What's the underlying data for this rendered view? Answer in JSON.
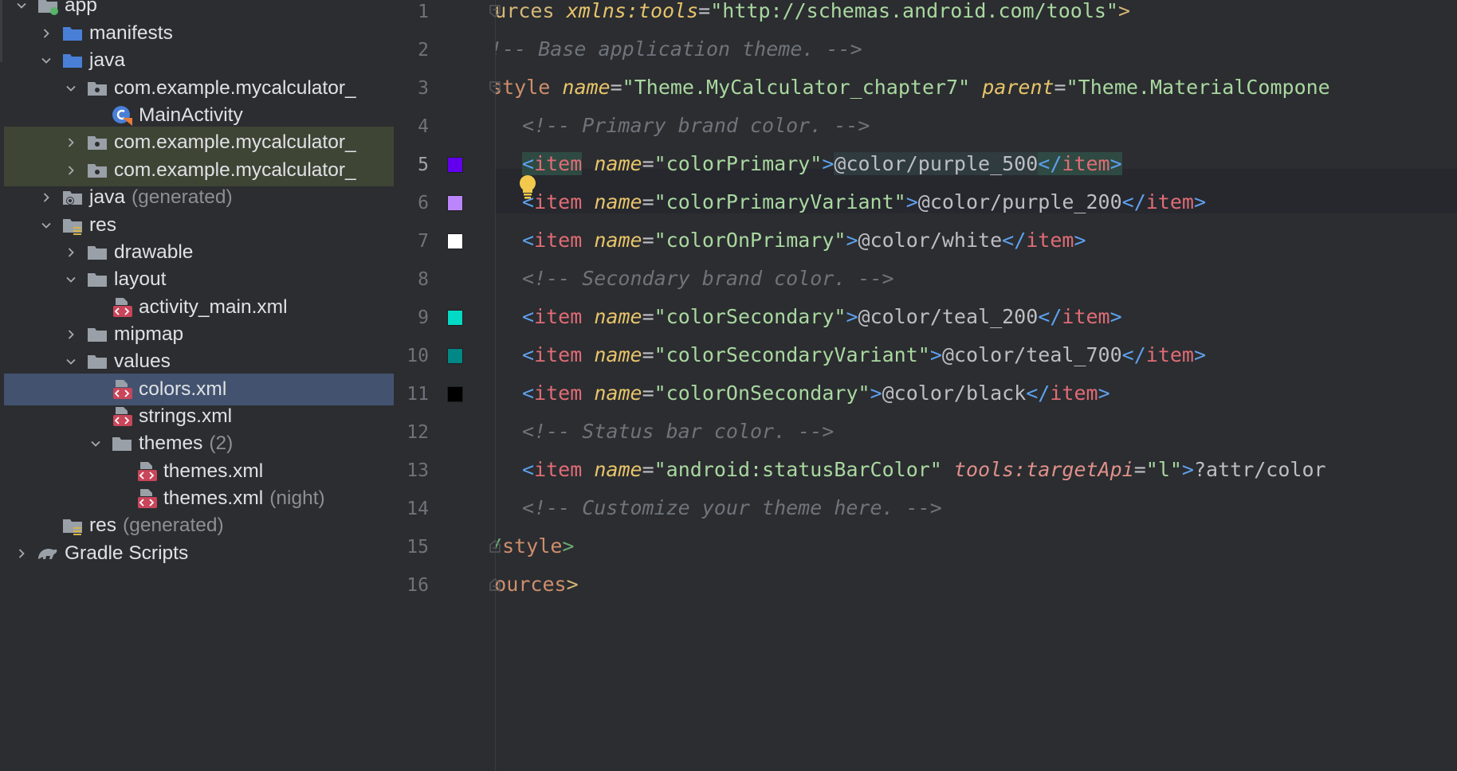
{
  "tree": {
    "items": [
      {
        "label": "app",
        "extra": "",
        "icon": "module-folder-icon",
        "chevron": "down"
      },
      {
        "label": "manifests",
        "extra": "",
        "icon": "folder-icon",
        "chevron": "right"
      },
      {
        "label": "java",
        "extra": "",
        "icon": "folder-icon",
        "chevron": "down"
      },
      {
        "label": "com.example.mycalculator_",
        "extra": "",
        "icon": "package-icon",
        "chevron": "down"
      },
      {
        "label": "MainActivity",
        "extra": "",
        "icon": "kotlin-class-icon",
        "chevron": ""
      },
      {
        "label": "com.example.mycalculator_",
        "extra": "",
        "icon": "package-icon",
        "chevron": "right"
      },
      {
        "label": "com.example.mycalculator_",
        "extra": "",
        "icon": "package-icon",
        "chevron": "right"
      },
      {
        "label": "java",
        "extra": "(generated)",
        "icon": "generated-folder-icon",
        "chevron": "right"
      },
      {
        "label": "res",
        "extra": "",
        "icon": "resource-folder-icon",
        "chevron": "down"
      },
      {
        "label": "drawable",
        "extra": "",
        "icon": "folder-icon",
        "chevron": "right"
      },
      {
        "label": "layout",
        "extra": "",
        "icon": "folder-icon",
        "chevron": "down"
      },
      {
        "label": "activity_main.xml",
        "extra": "",
        "icon": "xml-file-icon",
        "chevron": ""
      },
      {
        "label": "mipmap",
        "extra": "",
        "icon": "folder-icon",
        "chevron": "right"
      },
      {
        "label": "values",
        "extra": "",
        "icon": "folder-icon",
        "chevron": "down"
      },
      {
        "label": "colors.xml",
        "extra": "",
        "icon": "xml-file-icon",
        "chevron": ""
      },
      {
        "label": "strings.xml",
        "extra": "",
        "icon": "xml-file-icon",
        "chevron": ""
      },
      {
        "label": "themes",
        "extra": "(2)",
        "icon": "folder-icon",
        "chevron": "down"
      },
      {
        "label": "themes.xml",
        "extra": "",
        "icon": "xml-file-icon",
        "chevron": ""
      },
      {
        "label": "themes.xml",
        "extra": "(night)",
        "icon": "xml-file-icon",
        "chevron": ""
      },
      {
        "label": "res",
        "extra": "(generated)",
        "icon": "resource-folder-icon",
        "chevron": ""
      },
      {
        "label": "Gradle Scripts",
        "extra": "",
        "icon": "gradle-icon",
        "chevron": "right"
      }
    ]
  },
  "editor": {
    "line_numbers": [
      "1",
      "2",
      "3",
      "4",
      "5",
      "6",
      "7",
      "8",
      "9",
      "10",
      "11",
      "12",
      "13",
      "14",
      "15",
      "16"
    ],
    "current_line": "5",
    "swatches": {
      "purple_500": "#6200ee",
      "purple_200": "#bb86fc",
      "white": "#ffffff",
      "teal_200": "#03dac5",
      "teal_700": "#018786",
      "black": "#000000"
    },
    "lines": {
      "l1": {
        "open": "<",
        "tag": "resources",
        "sp": " ",
        "ns": "xmlns:",
        "nsattr": "tools",
        "eq": "=",
        "str": "\"http://schemas.android.com/tools\"",
        "close": ">"
      },
      "l2": {
        "comment": "<!-- Base application theme. -->"
      },
      "l3": {
        "open": "<",
        "tag": "style",
        "sp": " ",
        "a1": "name",
        "eq1": "=",
        "s1": "\"Theme.MyCalculator_chapter7\"",
        "sp2": " ",
        "a2": "parent",
        "eq2": "=",
        "s2": "\"Theme.MaterialCompone"
      },
      "l4": {
        "comment": "<!-- Primary brand color. -->"
      },
      "l5": {
        "open": "<",
        "tag": "item",
        "sp": " ",
        "attr": "name",
        "eq": "=",
        "str": "\"colorPrimary\"",
        "gt": ">",
        "value": "@color/purple_500",
        "endopen": "</",
        "endtag": "item",
        "endclose": ">"
      },
      "l6": {
        "open": "<",
        "tag": "item",
        "sp": " ",
        "attr": "name",
        "eq": "=",
        "str": "\"colorPrimaryVariant\"",
        "gt": ">",
        "value": "@color/purple_200",
        "endopen": "</",
        "endtag": "item",
        "endclose": ">"
      },
      "l7": {
        "open": "<",
        "tag": "item",
        "sp": " ",
        "attr": "name",
        "eq": "=",
        "str": "\"colorOnPrimary\"",
        "gt": ">",
        "value": "@color/white",
        "endopen": "</",
        "endtag": "item",
        "endclose": ">"
      },
      "l8": {
        "comment": "<!-- Secondary brand color. -->"
      },
      "l9": {
        "open": "<",
        "tag": "item",
        "sp": " ",
        "attr": "name",
        "eq": "=",
        "str": "\"colorSecondary\"",
        "gt": ">",
        "value": "@color/teal_200",
        "endopen": "</",
        "endtag": "item",
        "endclose": ">"
      },
      "l10": {
        "open": "<",
        "tag": "item",
        "sp": " ",
        "attr": "name",
        "eq": "=",
        "str": "\"colorSecondaryVariant\"",
        "gt": ">",
        "value": "@color/teal_700",
        "endopen": "</",
        "endtag": "item",
        "endclose": ">"
      },
      "l11": {
        "open": "<",
        "tag": "item",
        "sp": " ",
        "attr": "name",
        "eq": "=",
        "str": "\"colorOnSecondary\"",
        "gt": ">",
        "value": "@color/black",
        "endopen": "</",
        "endtag": "item",
        "endclose": ">"
      },
      "l12": {
        "comment": "<!-- Status bar color. -->"
      },
      "l13": {
        "open": "<",
        "tag": "item",
        "sp": " ",
        "attr": "name",
        "eq": "=",
        "str": "\"android:statusBarColor\"",
        "sp2": " ",
        "ns": "tools:",
        "nsattr": "targetApi",
        "eq2": "=",
        "str2": "\"l\"",
        "gt": ">",
        "value": "?attr/color"
      },
      "l14": {
        "comment": "<!-- Customize your theme here. -->"
      },
      "l15": {
        "endopen": "</",
        "endtag": "style",
        "endclose": ">"
      },
      "l16": {
        "endopen": "</",
        "endtag": "resources",
        "endclose": ">"
      }
    }
  }
}
